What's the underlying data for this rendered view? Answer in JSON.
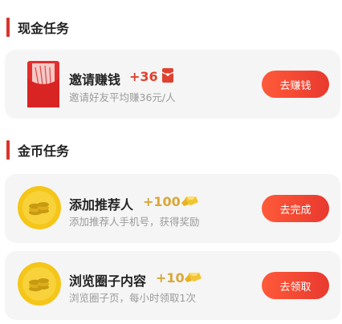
{
  "sections": {
    "cash": {
      "title": "现金任务"
    },
    "gold": {
      "title": "金币任务"
    }
  },
  "tasks": [
    {
      "title": "邀请赚钱",
      "reward": "+36",
      "reward_color": "#e0412f",
      "desc": "邀请好友平均赚36元/人",
      "button": "去赚钱"
    },
    {
      "title": "添加推荐人",
      "reward": "+100",
      "reward_color": "#d9a73a",
      "desc": "添加推荐人手机号，获得奖励",
      "button": "去完成"
    },
    {
      "title": "浏览圈子内容",
      "reward": "+10",
      "reward_color": "#d9a73a",
      "desc": "浏览圈子页，每小时领取1次",
      "button": "去领取"
    }
  ],
  "colors": {
    "accent": "#d9342b",
    "button": "#ec3d2f",
    "card_bg": "#f5f5f5"
  }
}
